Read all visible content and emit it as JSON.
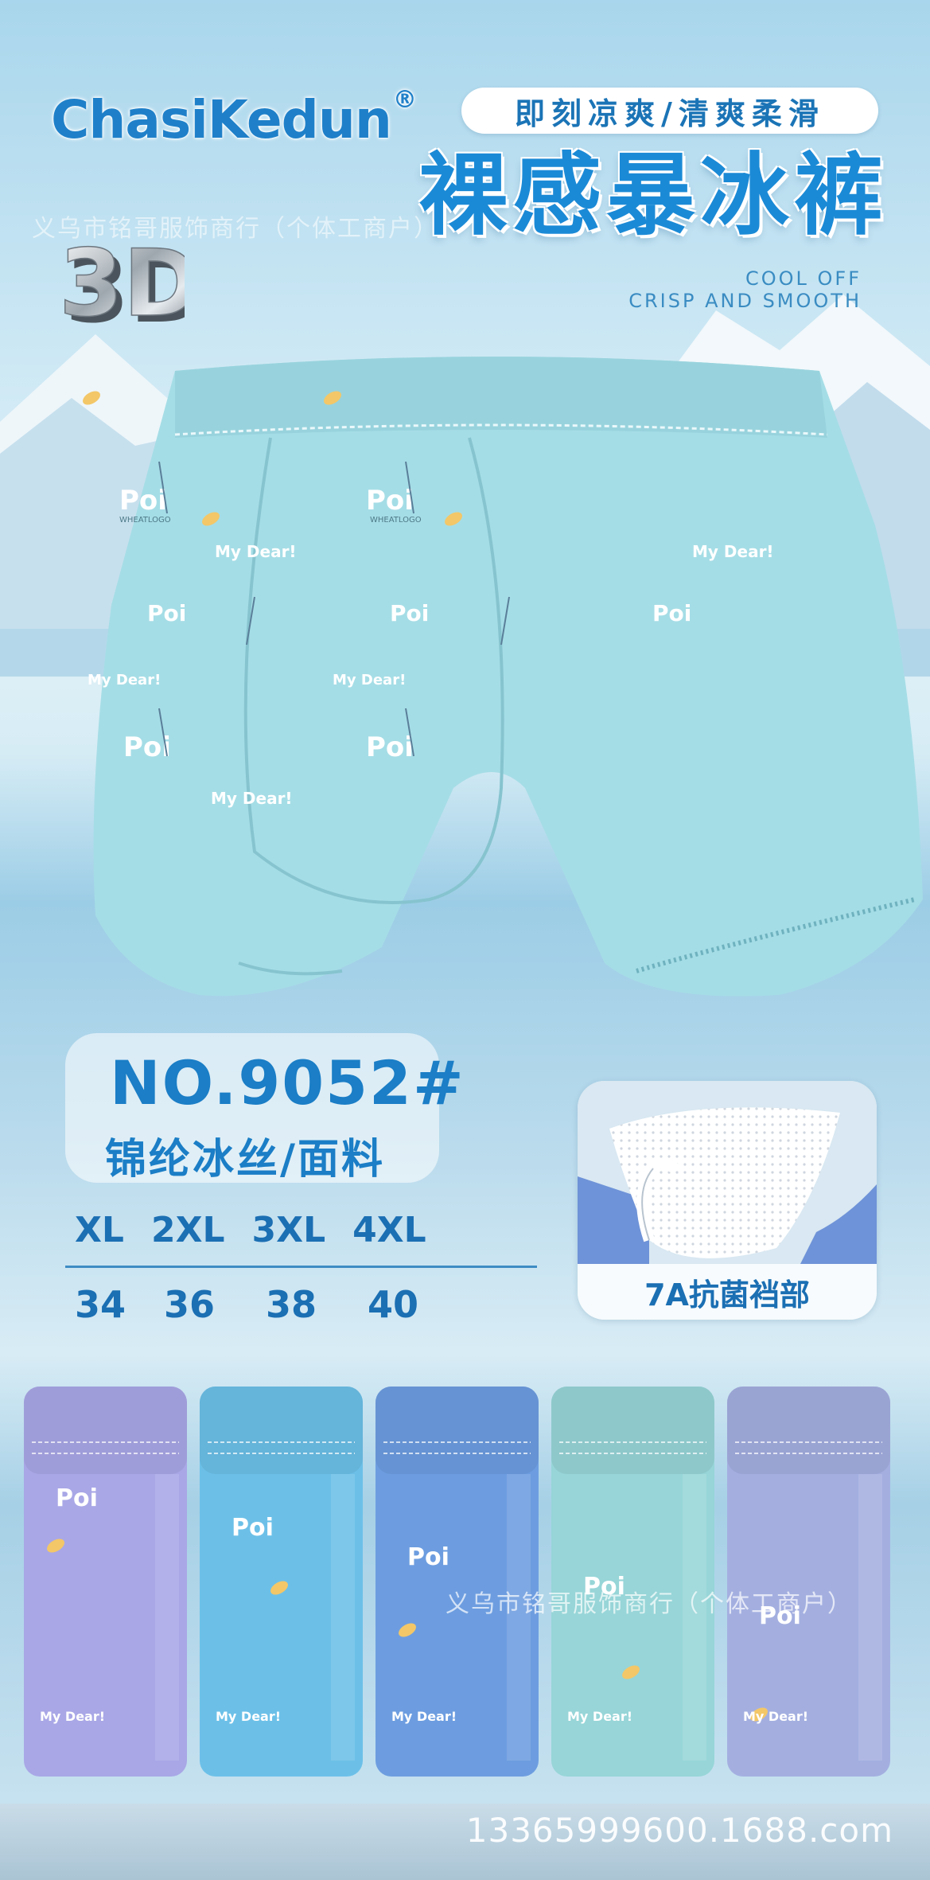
{
  "brand": {
    "name": "ChasiKedun",
    "reg": "®"
  },
  "badge_3d": "3D",
  "tagline_pill": "即刻凉爽/清爽柔滑",
  "headline": "裸感暴冰裤",
  "english_lines": [
    "COOL OFF",
    "CRISP AND SMOOTH"
  ],
  "watermarks": [
    "义乌市铭哥服饰商行（个体工商户）",
    "义乌市铭哥服饰商行（个体工商户）"
  ],
  "product_prints": {
    "poi": "Poi",
    "wheat": "WHEATLOGO",
    "dear": "My Dear!"
  },
  "model_number": "NO.9052#",
  "fabric": "锦纶冰丝/面料",
  "sizes": [
    "XL",
    "2XL",
    "3XL",
    "4XL"
  ],
  "waist_values": [
    "34",
    "36",
    "38",
    "40"
  ],
  "feature": {
    "label": "7A抗菌裆部"
  },
  "color_variants": [
    {
      "color": "#a9a7e6"
    },
    {
      "color": "#6cc0e8"
    },
    {
      "color": "#6d9de0"
    },
    {
      "color": "#97d5d8"
    },
    {
      "color": "#a4afe0"
    }
  ],
  "contact": "13365999600.1688.com",
  "colors": {
    "accent": "#1b7ec6",
    "product": "#a5dde6"
  }
}
